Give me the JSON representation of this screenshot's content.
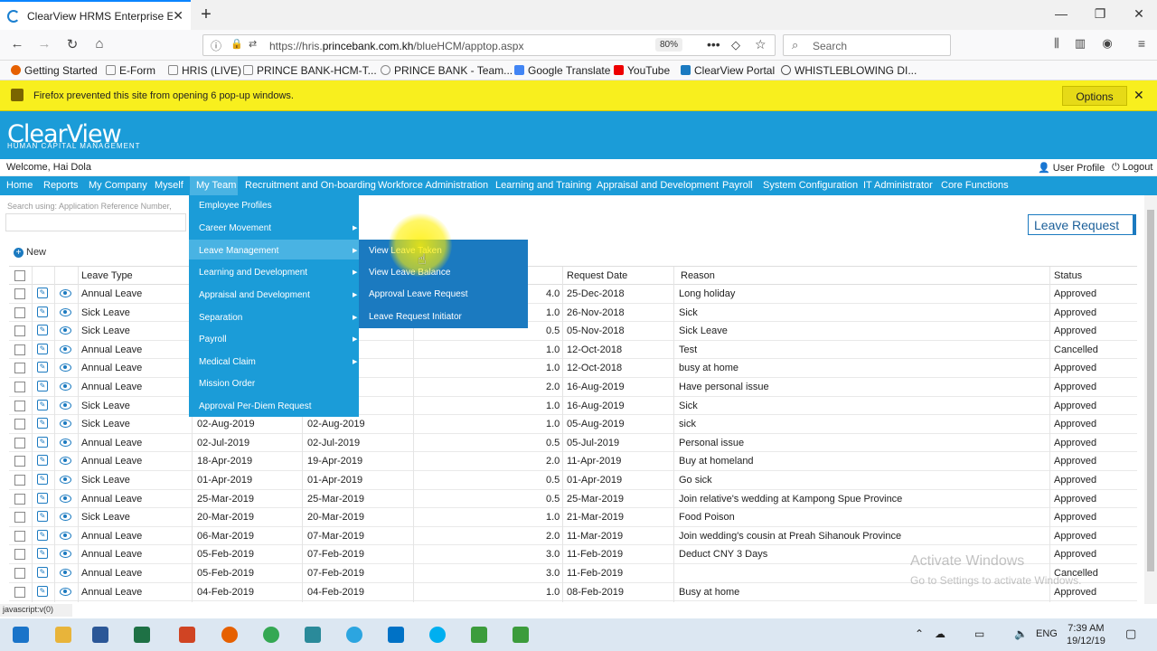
{
  "browser": {
    "tab_title": "ClearView HRMS Enterprise Ed",
    "url_prefix": "https://hris.",
    "url_domain": "princebank.com.kh",
    "url_path": "/blueHCM/apptop.aspx",
    "zoom": "80%",
    "search_placeholder": "Search",
    "bookmarks": [
      "Getting Started",
      "E-Form",
      "HRIS (LIVE)",
      "PRINCE BANK-HCM-T...",
      "PRINCE BANK - Team...",
      "Google Translate",
      "YouTube",
      "ClearView Portal",
      "WHISTLEBLOWING DI..."
    ],
    "popup_message": "Firefox prevented this site from opening 6 pop-up windows.",
    "popup_options": "Options",
    "status_text": "javascript:v(0)"
  },
  "app": {
    "logo": "ClearView",
    "logo_sub": "HUMAN CAPITAL MANAGEMENT",
    "welcome": "Welcome, Hai Dola",
    "user_profile": "User Profile",
    "logout": "Logout",
    "menu": [
      "Home",
      "Reports",
      "My Company",
      "Myself",
      "My Team",
      "Recruitment and On-boarding",
      "Workforce Administration",
      "Learning and Training",
      "Appraisal and Development",
      "Payroll",
      "System Configuration",
      "IT Administrator",
      "Core Functions"
    ],
    "search_label": "Search using: Application Reference Number,",
    "new_label": "New",
    "page_button": "Leave Request"
  },
  "dropdown": {
    "items": [
      "Employee Profiles",
      "Career Movement",
      "Leave Management",
      "Learning and Development",
      "Appraisal and Development",
      "Separation",
      "Payroll",
      "Medical Claim",
      "Mission Order",
      "Approval Per-Diem Request"
    ],
    "sub_items": [
      "View Leave Taken",
      "View Leave Balance",
      "Approval Leave Request",
      "Leave Request Initiator"
    ]
  },
  "table": {
    "headers": {
      "leave_type": "Leave Type",
      "request_date": "Request Date",
      "reason": "Reason",
      "status": "Status"
    },
    "rows": [
      {
        "type": "Annual Leave",
        "from": "",
        "to": "",
        "days": "4.0",
        "req": "25-Dec-2018",
        "reason": "Long holiday",
        "status": "Approved"
      },
      {
        "type": "Sick Leave",
        "from": "",
        "to": "",
        "days": "1.0",
        "req": "26-Nov-2018",
        "reason": "Sick",
        "status": "Approved"
      },
      {
        "type": "Sick Leave",
        "from": "",
        "to": "",
        "days": "0.5",
        "req": "05-Nov-2018",
        "reason": "Sick Leave",
        "status": "Approved"
      },
      {
        "type": "Annual Leave",
        "from": "",
        "to": "",
        "days": "1.0",
        "req": "12-Oct-2018",
        "reason": "Test",
        "status": "Cancelled"
      },
      {
        "type": "Annual Leave",
        "from": "",
        "to": "",
        "days": "1.0",
        "req": "12-Oct-2018",
        "reason": "busy at home",
        "status": "Approved"
      },
      {
        "type": "Annual Leave",
        "from": "",
        "to": "",
        "days": "2.0",
        "req": "16-Aug-2019",
        "reason": "Have personal issue",
        "status": "Approved"
      },
      {
        "type": "Sick Leave",
        "from": "",
        "to": "",
        "days": "1.0",
        "req": "16-Aug-2019",
        "reason": "Sick",
        "status": "Approved"
      },
      {
        "type": "Sick Leave",
        "from": "02-Aug-2019",
        "to": "02-Aug-2019",
        "days": "1.0",
        "req": "05-Aug-2019",
        "reason": "sick",
        "status": "Approved"
      },
      {
        "type": "Annual Leave",
        "from": "02-Jul-2019",
        "to": "02-Jul-2019",
        "days": "0.5",
        "req": "05-Jul-2019",
        "reason": "Personal issue",
        "status": "Approved"
      },
      {
        "type": "Annual Leave",
        "from": "18-Apr-2019",
        "to": "19-Apr-2019",
        "days": "2.0",
        "req": "11-Apr-2019",
        "reason": "Buy at homeland",
        "status": "Approved"
      },
      {
        "type": "Sick Leave",
        "from": "01-Apr-2019",
        "to": "01-Apr-2019",
        "days": "0.5",
        "req": "01-Apr-2019",
        "reason": "Go sick",
        "status": "Approved"
      },
      {
        "type": "Annual Leave",
        "from": "25-Mar-2019",
        "to": "25-Mar-2019",
        "days": "0.5",
        "req": "25-Mar-2019",
        "reason": "Join relative's wedding at Kampong Spue Province",
        "status": "Approved"
      },
      {
        "type": "Sick Leave",
        "from": "20-Mar-2019",
        "to": "20-Mar-2019",
        "days": "1.0",
        "req": "21-Mar-2019",
        "reason": "Food Poison",
        "status": "Approved"
      },
      {
        "type": "Annual Leave",
        "from": "06-Mar-2019",
        "to": "07-Mar-2019",
        "days": "2.0",
        "req": "11-Mar-2019",
        "reason": "Join wedding's cousin at Preah Sihanouk Province",
        "status": "Approved"
      },
      {
        "type": "Annual Leave",
        "from": "05-Feb-2019",
        "to": "07-Feb-2019",
        "days": "3.0",
        "req": "11-Feb-2019",
        "reason": "Deduct CNY 3 Days",
        "status": "Approved"
      },
      {
        "type": "Annual Leave",
        "from": "05-Feb-2019",
        "to": "07-Feb-2019",
        "days": "3.0",
        "req": "11-Feb-2019",
        "reason": "",
        "status": "Cancelled"
      },
      {
        "type": "Annual Leave",
        "from": "04-Feb-2019",
        "to": "04-Feb-2019",
        "days": "1.0",
        "req": "08-Feb-2019",
        "reason": "Busy at home",
        "status": "Approved"
      }
    ]
  },
  "watermark": {
    "line1": "Activate Windows",
    "line2": "Go to Settings to activate Windows."
  },
  "taskbar": {
    "time": "7:39 AM",
    "date": "19/12/19",
    "lang": "ENG"
  }
}
